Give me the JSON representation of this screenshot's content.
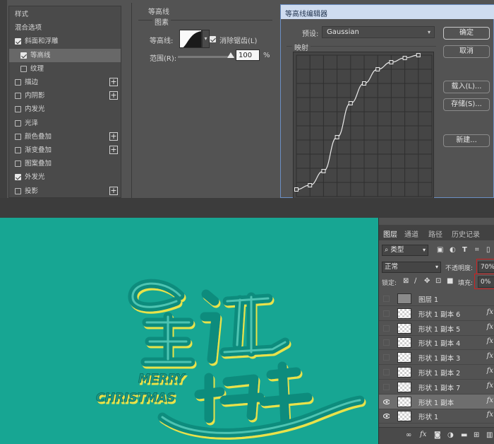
{
  "layer_style": {
    "styles_list": [
      {
        "label": "样式",
        "checkbox": false,
        "checked": false,
        "plus": false,
        "indent": 0,
        "highlight": false
      },
      {
        "label": "混合选项",
        "checkbox": false,
        "checked": false,
        "plus": false,
        "indent": 0,
        "highlight": false
      },
      {
        "label": "斜面和浮雕",
        "checkbox": true,
        "checked": true,
        "plus": false,
        "indent": 0,
        "highlight": false
      },
      {
        "label": "等高线",
        "checkbox": true,
        "checked": true,
        "plus": false,
        "indent": 1,
        "highlight": true
      },
      {
        "label": "纹理",
        "checkbox": true,
        "checked": false,
        "plus": false,
        "indent": 1,
        "highlight": false
      },
      {
        "label": "描边",
        "checkbox": true,
        "checked": false,
        "plus": true,
        "indent": 0,
        "highlight": false
      },
      {
        "label": "内阴影",
        "checkbox": true,
        "checked": false,
        "plus": true,
        "indent": 0,
        "highlight": false
      },
      {
        "label": "内发光",
        "checkbox": true,
        "checked": false,
        "plus": false,
        "indent": 0,
        "highlight": false
      },
      {
        "label": "光泽",
        "checkbox": true,
        "checked": false,
        "plus": false,
        "indent": 0,
        "highlight": false
      },
      {
        "label": "颜色叠加",
        "checkbox": true,
        "checked": false,
        "plus": true,
        "indent": 0,
        "highlight": false
      },
      {
        "label": "渐变叠加",
        "checkbox": true,
        "checked": false,
        "plus": true,
        "indent": 0,
        "highlight": false
      },
      {
        "label": "图案叠加",
        "checkbox": true,
        "checked": false,
        "plus": false,
        "indent": 0,
        "highlight": false
      },
      {
        "label": "外发光",
        "checkbox": true,
        "checked": true,
        "plus": false,
        "indent": 0,
        "highlight": false
      },
      {
        "label": "投影",
        "checkbox": true,
        "checked": false,
        "plus": true,
        "indent": 0,
        "highlight": false
      }
    ],
    "contour_section": {
      "title": "等高线",
      "subtitle": "图素",
      "contour_label": "等高线:",
      "antialias_label": "消除锯齿(L)",
      "antialias_checked": true,
      "range_label": "范围(R):",
      "range_value": "100",
      "range_unit": "%",
      "range_fraction": 1.0
    }
  },
  "contour_editor": {
    "title": "等高线编辑器",
    "preset_label": "预设:",
    "preset_value": "Gaussian",
    "mapping_label": "映射",
    "buttons": {
      "ok": "确定",
      "cancel": "取消",
      "load": "载入(L)...",
      "save": "存储(S)...",
      "new": "新建..."
    },
    "curve_points": [
      [
        0.0,
        0.05
      ],
      [
        0.1,
        0.08
      ],
      [
        0.2,
        0.18
      ],
      [
        0.3,
        0.42
      ],
      [
        0.4,
        0.66
      ],
      [
        0.5,
        0.8
      ],
      [
        0.6,
        0.9
      ],
      [
        0.7,
        0.95
      ],
      [
        0.8,
        0.98
      ],
      [
        0.9,
        1.0
      ]
    ]
  },
  "canvas": {
    "background_color": "#17a693",
    "art_text": {
      "merry": "MERRY",
      "christmas": "CHRISTMAS"
    }
  },
  "layers_panel": {
    "tabs": [
      "图层",
      "通道",
      "路径",
      "历史记录"
    ],
    "active_tab": 0,
    "filter_label": "类型",
    "blend_mode": "正常",
    "opacity_label": "不透明度:",
    "opacity_value": "70%",
    "lock_label": "锁定:",
    "fill_label": "填充:",
    "fill_value": "0%",
    "layers": [
      {
        "name": "图层 1",
        "visible": false,
        "fx": false,
        "selected": false,
        "thumb": "gray"
      },
      {
        "name": "形状 1 副本 6",
        "visible": false,
        "fx": true,
        "selected": false,
        "thumb": "transparent"
      },
      {
        "name": "形状 1 副本 5",
        "visible": false,
        "fx": true,
        "selected": false,
        "thumb": "transparent"
      },
      {
        "name": "形状 1 副本 4",
        "visible": false,
        "fx": true,
        "selected": false,
        "thumb": "transparent"
      },
      {
        "name": "形状 1 副本 3",
        "visible": false,
        "fx": true,
        "selected": false,
        "thumb": "transparent"
      },
      {
        "name": "形状 1 副本 2",
        "visible": false,
        "fx": true,
        "selected": false,
        "thumb": "transparent"
      },
      {
        "name": "形状 1 副本 7",
        "visible": false,
        "fx": true,
        "selected": false,
        "thumb": "transparent"
      },
      {
        "name": "形状 1 副本",
        "visible": true,
        "fx": true,
        "selected": true,
        "thumb": "transparent"
      },
      {
        "name": "形状 1",
        "visible": true,
        "fx": true,
        "selected": false,
        "thumb": "transparent"
      }
    ],
    "footer_icons": [
      "link-icon",
      "fx-icon",
      "mask-icon",
      "adjustment-icon",
      "group-icon",
      "new-layer-icon",
      "trash-icon"
    ]
  }
}
